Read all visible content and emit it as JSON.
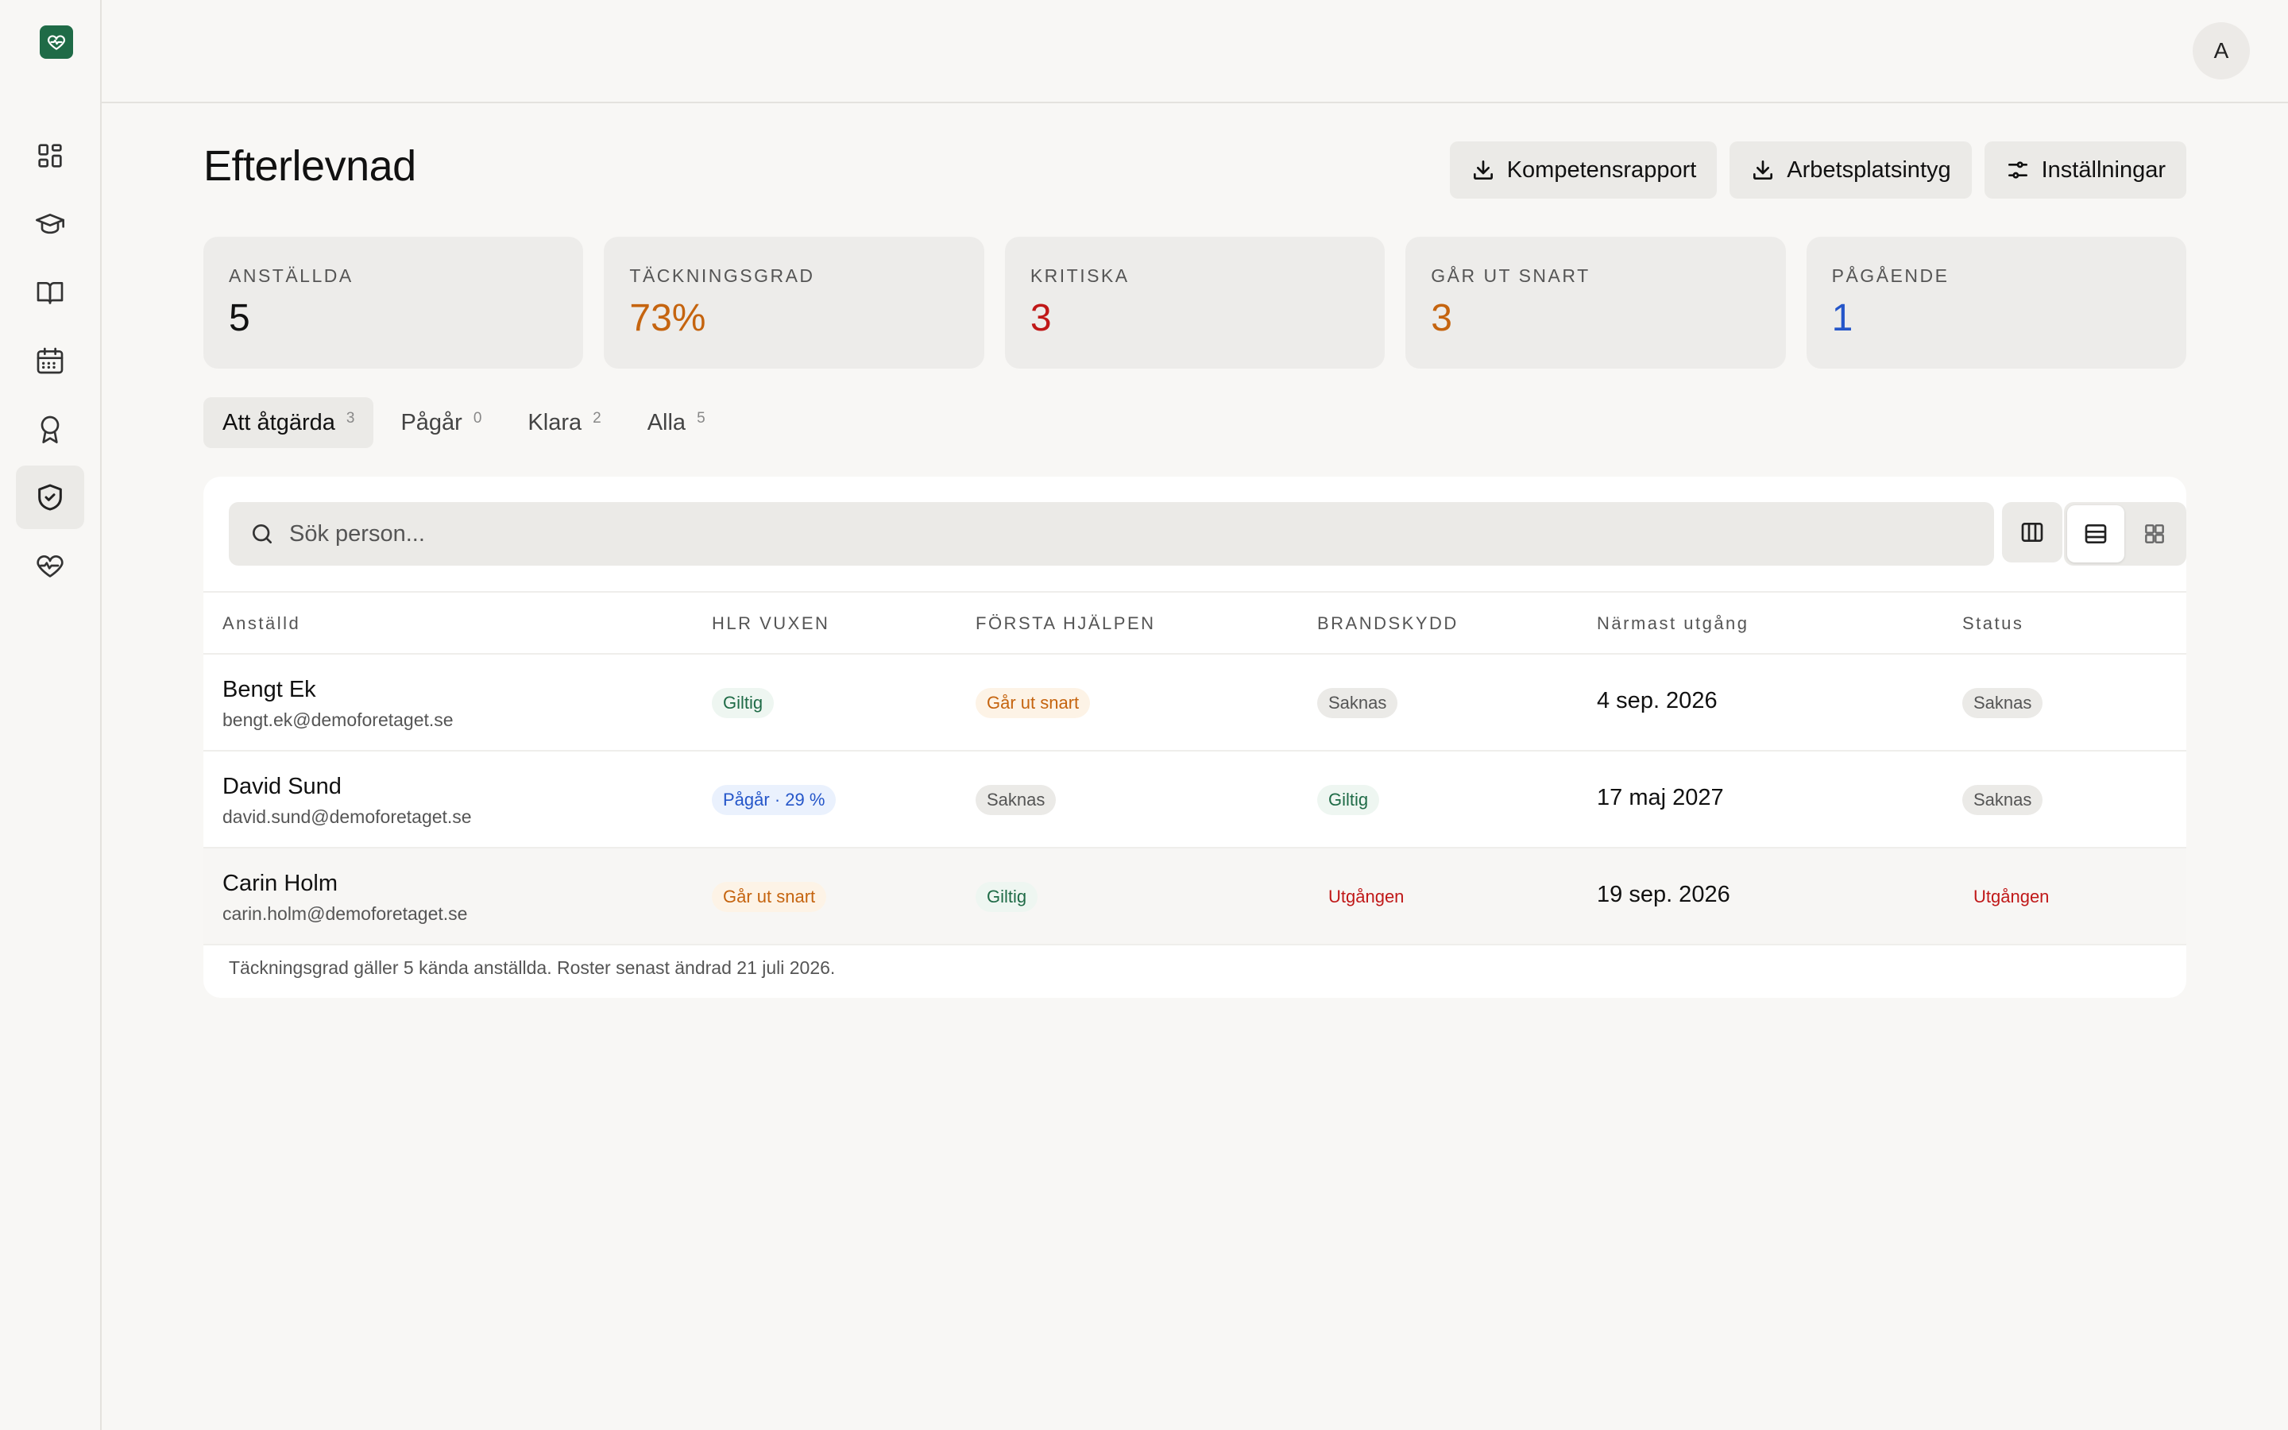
{
  "page": {
    "title": "Efterlevnad"
  },
  "user": {
    "avatar_initial": "A"
  },
  "sidebar": {
    "items": [
      {
        "icon": "dashboard-icon"
      },
      {
        "icon": "graduation-cap-icon"
      },
      {
        "icon": "book-icon"
      },
      {
        "icon": "calendar-icon"
      },
      {
        "icon": "award-icon"
      },
      {
        "icon": "shield-check-icon",
        "active": true
      },
      {
        "icon": "heart-pulse-icon"
      }
    ]
  },
  "actions": {
    "competence_report": "Kompetensrapport",
    "workplace_certificate": "Arbetsplatsintyg",
    "settings": "Inställningar"
  },
  "stats": [
    {
      "label": "ANSTÄLLDA",
      "value": "5",
      "color": "#111111"
    },
    {
      "label": "TÄCKNINGSGRAD",
      "value": "73%",
      "color": "#c5640f"
    },
    {
      "label": "KRITISKA",
      "value": "3",
      "color": "#c01818"
    },
    {
      "label": "GÅR UT SNART",
      "value": "3",
      "color": "#c5640f"
    },
    {
      "label": "PÅGÅENDE",
      "value": "1",
      "color": "#2556c9"
    }
  ],
  "tabs": [
    {
      "label": "Att åtgärda",
      "count": "3",
      "active": true
    },
    {
      "label": "Pågår",
      "count": "0"
    },
    {
      "label": "Klara",
      "count": "2"
    },
    {
      "label": "Alla",
      "count": "5"
    }
  ],
  "search": {
    "placeholder": "Sök person..."
  },
  "table": {
    "columns": [
      "Anställd",
      "HLR VUXEN",
      "FÖRSTA HJÄLPEN",
      "BRANDSKYDD",
      "Närmast utgång",
      "Status"
    ],
    "rows": [
      {
        "name": "Bengt Ek",
        "email": "bengt.ek@demoforetaget.se",
        "hlr": "Giltig",
        "first_aid": "Går ut snart",
        "fire": "Saknas",
        "expiry": "4 sep. 2026",
        "status": "Saknas"
      },
      {
        "name": "David Sund",
        "email": "david.sund@demoforetaget.se",
        "hlr": "Pågår · 29 %",
        "first_aid": "Saknas",
        "fire": "Giltig",
        "expiry": "17 maj 2027",
        "status": "Saknas"
      },
      {
        "name": "Carin Holm",
        "email": "carin.holm@demoforetaget.se",
        "hlr": "Går ut snart",
        "first_aid": "Giltig",
        "fire": "Utgången",
        "expiry": "19 sep. 2026",
        "status": "Utgången"
      }
    ],
    "footnote": "Täckningsgrad gäller 5 kända anställda. Roster senast ändrad 21 juli 2026."
  }
}
